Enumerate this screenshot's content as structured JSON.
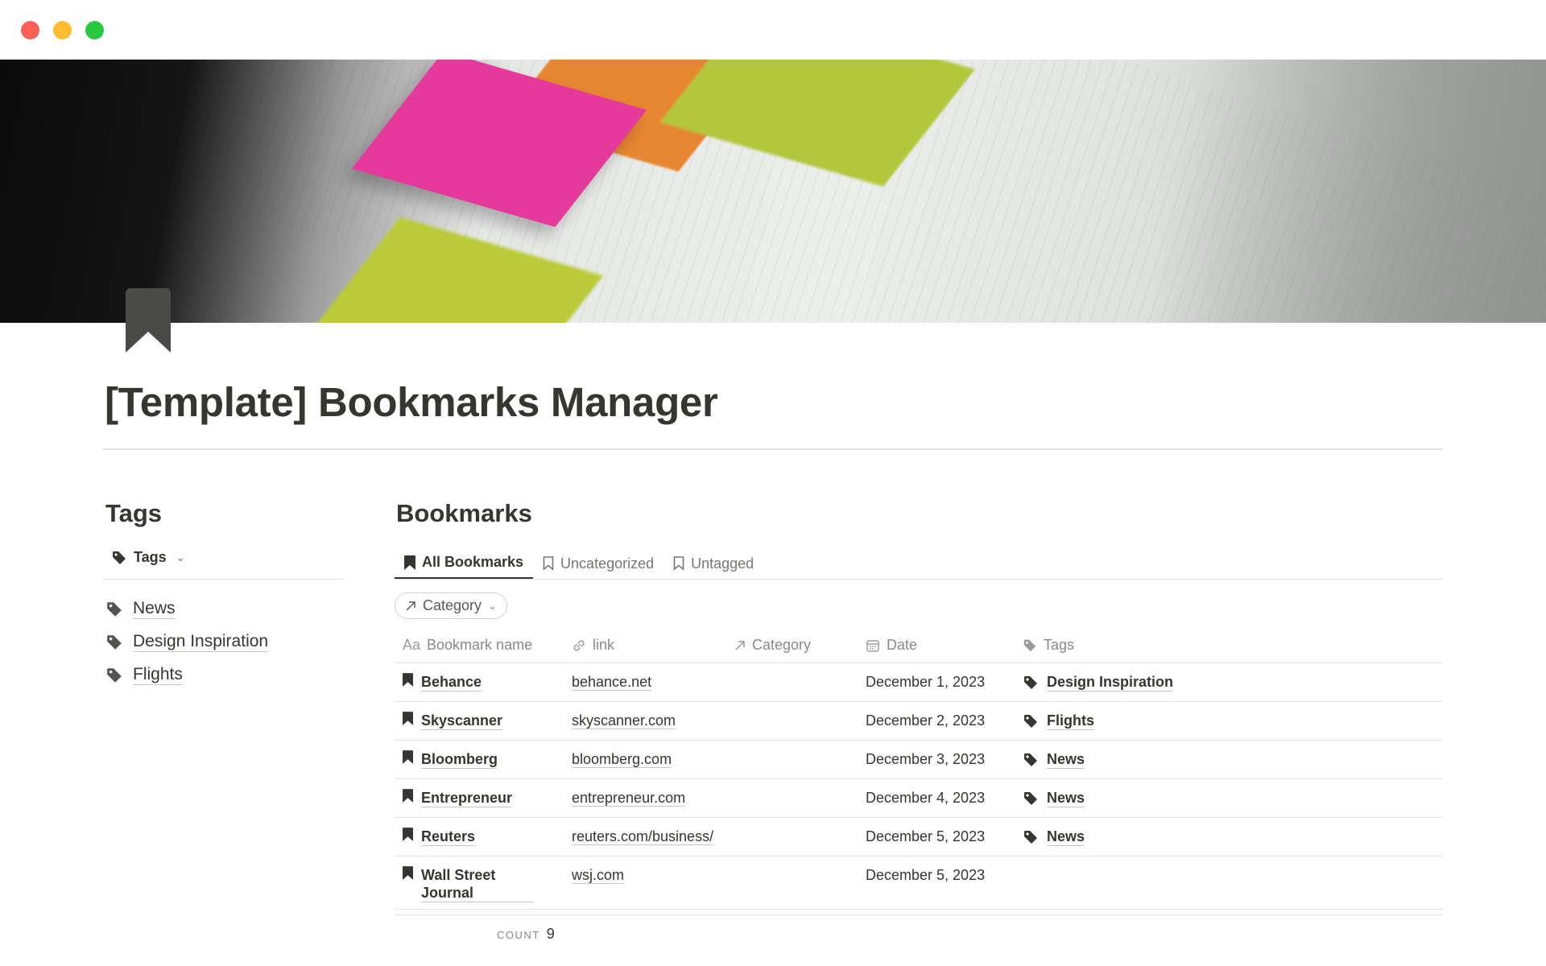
{
  "page": {
    "title": "[Template] Bookmarks Manager"
  },
  "tags_section": {
    "heading": "Tags",
    "view_label": "Tags",
    "items": [
      {
        "label": "News"
      },
      {
        "label": "Design Inspiration"
      },
      {
        "label": "Flights"
      }
    ]
  },
  "bookmarks_section": {
    "heading": "Bookmarks",
    "tabs": [
      {
        "label": "All Bookmarks",
        "active": true
      },
      {
        "label": "Uncategorized",
        "active": false
      },
      {
        "label": "Untagged",
        "active": false
      }
    ],
    "filter_label": "Category",
    "columns": [
      {
        "label": "Bookmark name",
        "icon": "text-icon",
        "prefix": "Aa"
      },
      {
        "label": "link",
        "icon": "link-icon"
      },
      {
        "label": "Category",
        "icon": "relation-arrow-icon"
      },
      {
        "label": "Date",
        "icon": "calendar-icon"
      },
      {
        "label": "Tags",
        "icon": "tag-icon"
      }
    ],
    "rows": [
      {
        "name": "Behance",
        "link": "behance.net",
        "category": "",
        "date": "December 1, 2023",
        "tag": "Design Inspiration"
      },
      {
        "name": "Skyscanner",
        "link": "skyscanner.com",
        "category": "",
        "date": "December 2, 2023",
        "tag": "Flights"
      },
      {
        "name": "Bloomberg",
        "link": "bloomberg.com",
        "category": "",
        "date": "December 3, 2023",
        "tag": "News"
      },
      {
        "name": "Entrepreneur",
        "link": "entrepreneur.com",
        "category": "",
        "date": "December 4, 2023",
        "tag": "News"
      },
      {
        "name": "Reuters",
        "link": "reuters.com/business/",
        "category": "",
        "date": "December 5, 2023",
        "tag": "News"
      },
      {
        "name": "Wall Street Journal",
        "link": "wsj.com",
        "category": "",
        "date": "December 5, 2023",
        "tag": ""
      }
    ],
    "count_label": "COUNT",
    "count_value": "9"
  },
  "colors": {
    "text": "#37352f",
    "muted": "#8b8985",
    "divider": "#e3e2df",
    "close": "#fe5f57",
    "minimize": "#febc2e",
    "zoom": "#28c840"
  }
}
